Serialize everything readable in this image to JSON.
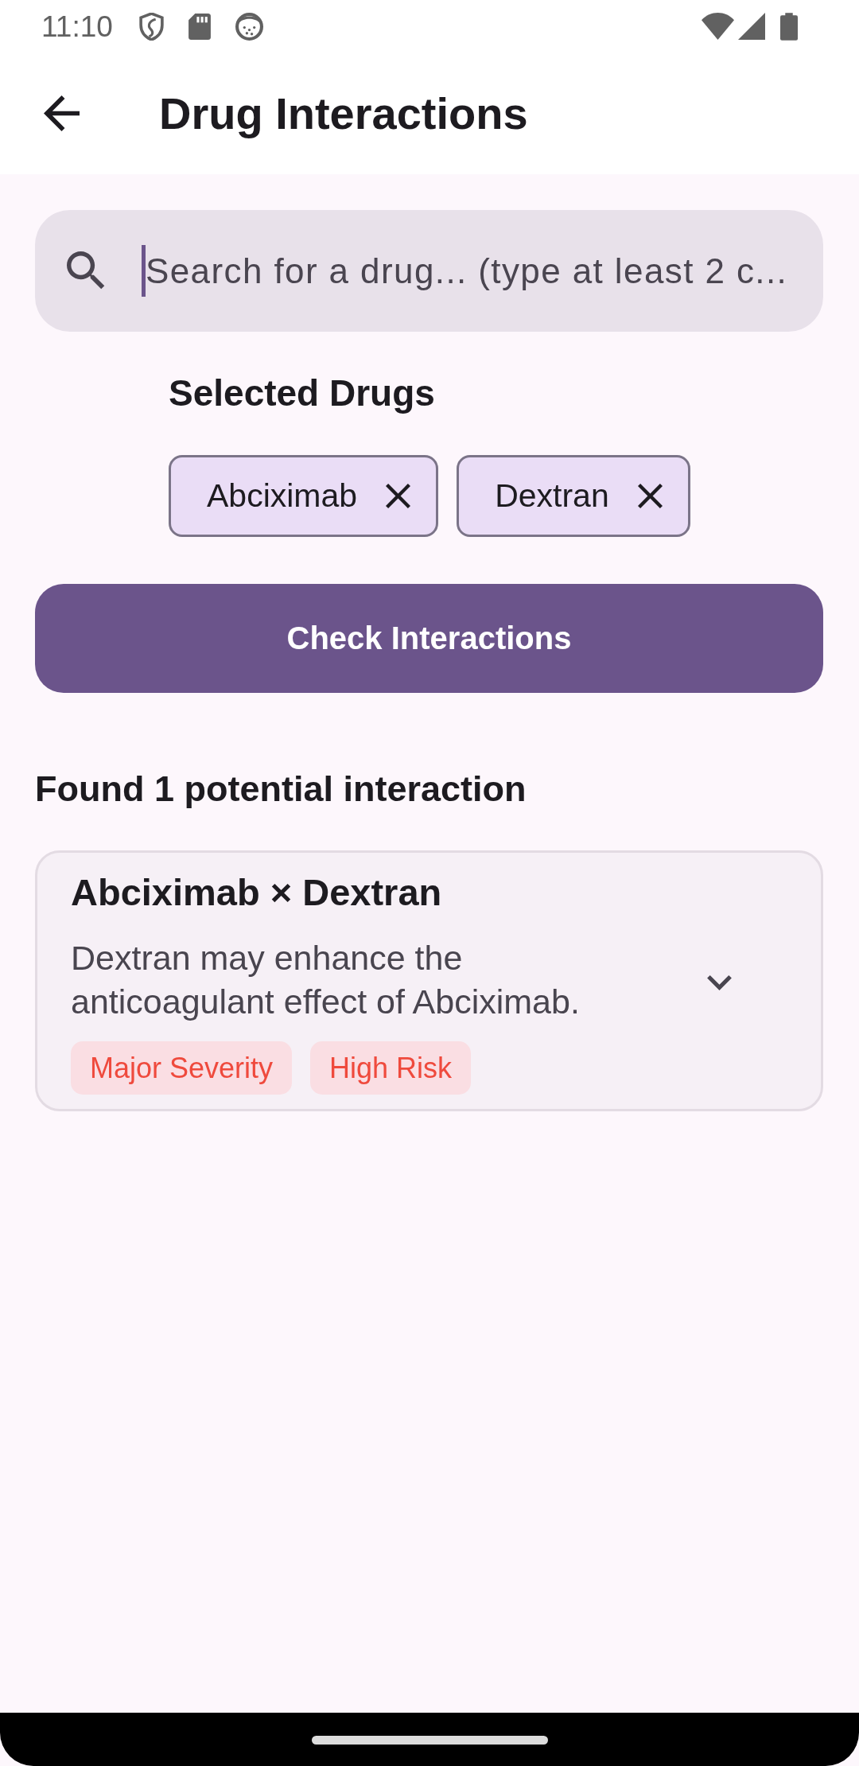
{
  "status_bar": {
    "time": "11:10"
  },
  "app_bar": {
    "title": "Drug Interactions"
  },
  "search": {
    "placeholder": "Search for a drug... (type at least 2 c...",
    "focused": true
  },
  "selected_drugs": {
    "heading": "Selected Drugs",
    "chips": [
      {
        "label": "Abciximab"
      },
      {
        "label": "Dextran"
      }
    ]
  },
  "check_button": {
    "label": "Check Interactions"
  },
  "results": {
    "heading": "Found 1 potential interaction",
    "interactions": [
      {
        "title": "Abciximab × Dextran",
        "description": "Dextran may enhance the anticoagulant effect of Abciximab.",
        "expanded": false,
        "tags": [
          {
            "label": "Major Severity"
          },
          {
            "label": "High Risk"
          }
        ]
      }
    ]
  }
}
